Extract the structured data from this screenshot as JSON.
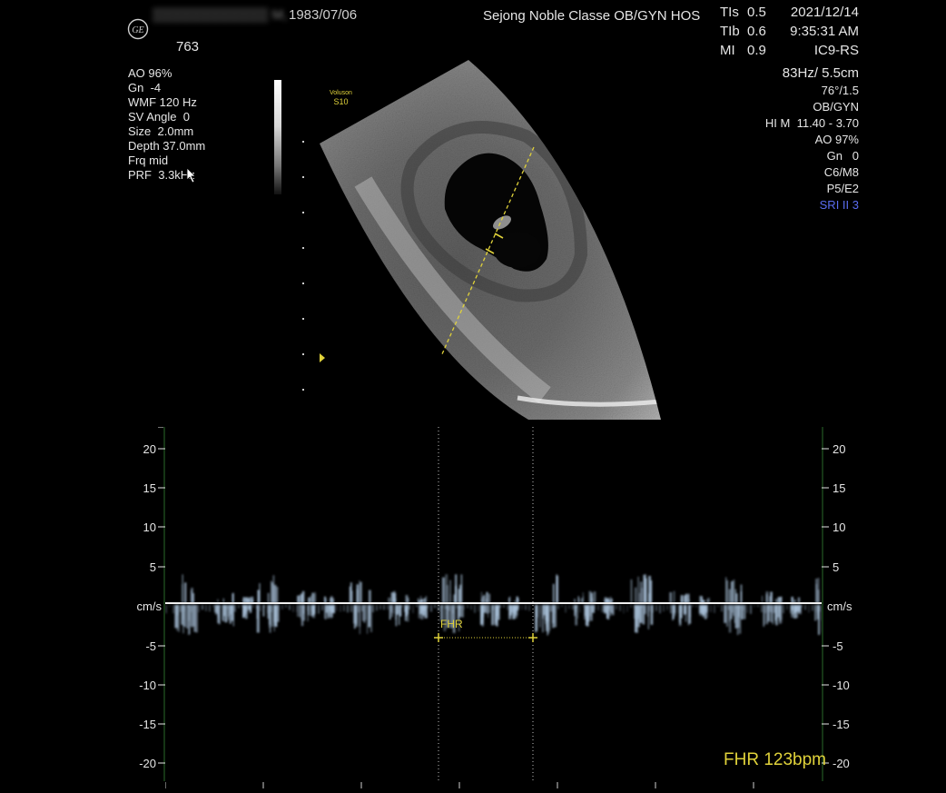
{
  "header": {
    "patient_name": "▒▒▒▒▒▒▒▒▒▒▒▒ M,",
    "patient_dob": "1983/07/06",
    "patient_id": "763",
    "institution": "Sejong Noble Classe OB/GYN HOS",
    "date": "2021/12/14",
    "time": "9:35:31 AM",
    "logo": "GE"
  },
  "safety_indices": [
    {
      "label": "TIs",
      "value": "0.5"
    },
    {
      "label": "TIb",
      "value": "0.6"
    },
    {
      "label": "MI",
      "value": "0.9"
    }
  ],
  "left_params": [
    "AO 96%",
    "Gn  -4",
    "WMF 120 Hz",
    "SV Angle  0",
    "Size  2.0mm",
    "Depth 37.0mm",
    "Frq mid",
    "PRF  3.3kHz"
  ],
  "right_params": [
    "IC9-RS",
    "83Hz/ 5.5cm",
    "76°/1.5",
    "OB/GYN",
    "HI M  11.40 - 3.70",
    "AO 97%",
    "Gn   0",
    "C6/M8",
    "P5/E2"
  ],
  "sri_label": "SRI II 3",
  "device_badge": {
    "line1": "Voluson",
    "line2": "S10"
  },
  "doppler": {
    "unit": "cm/s",
    "ticks": [
      "20",
      "15",
      "10",
      "5",
      "-5",
      "-10",
      "-15",
      "-20"
    ],
    "caliper_label": "FHR",
    "fhr_result": "FHR 123bpm"
  },
  "icons": {
    "logo": "ge-logo-icon",
    "cursor": "mouse-pointer-icon",
    "focus_marker": "focus-marker-icon"
  },
  "colors": {
    "background": "#000000",
    "text": "#e6e6e6",
    "measure": "#e0d23a",
    "sri": "#5a6cf0",
    "spectrum": "#a8c0d8"
  }
}
